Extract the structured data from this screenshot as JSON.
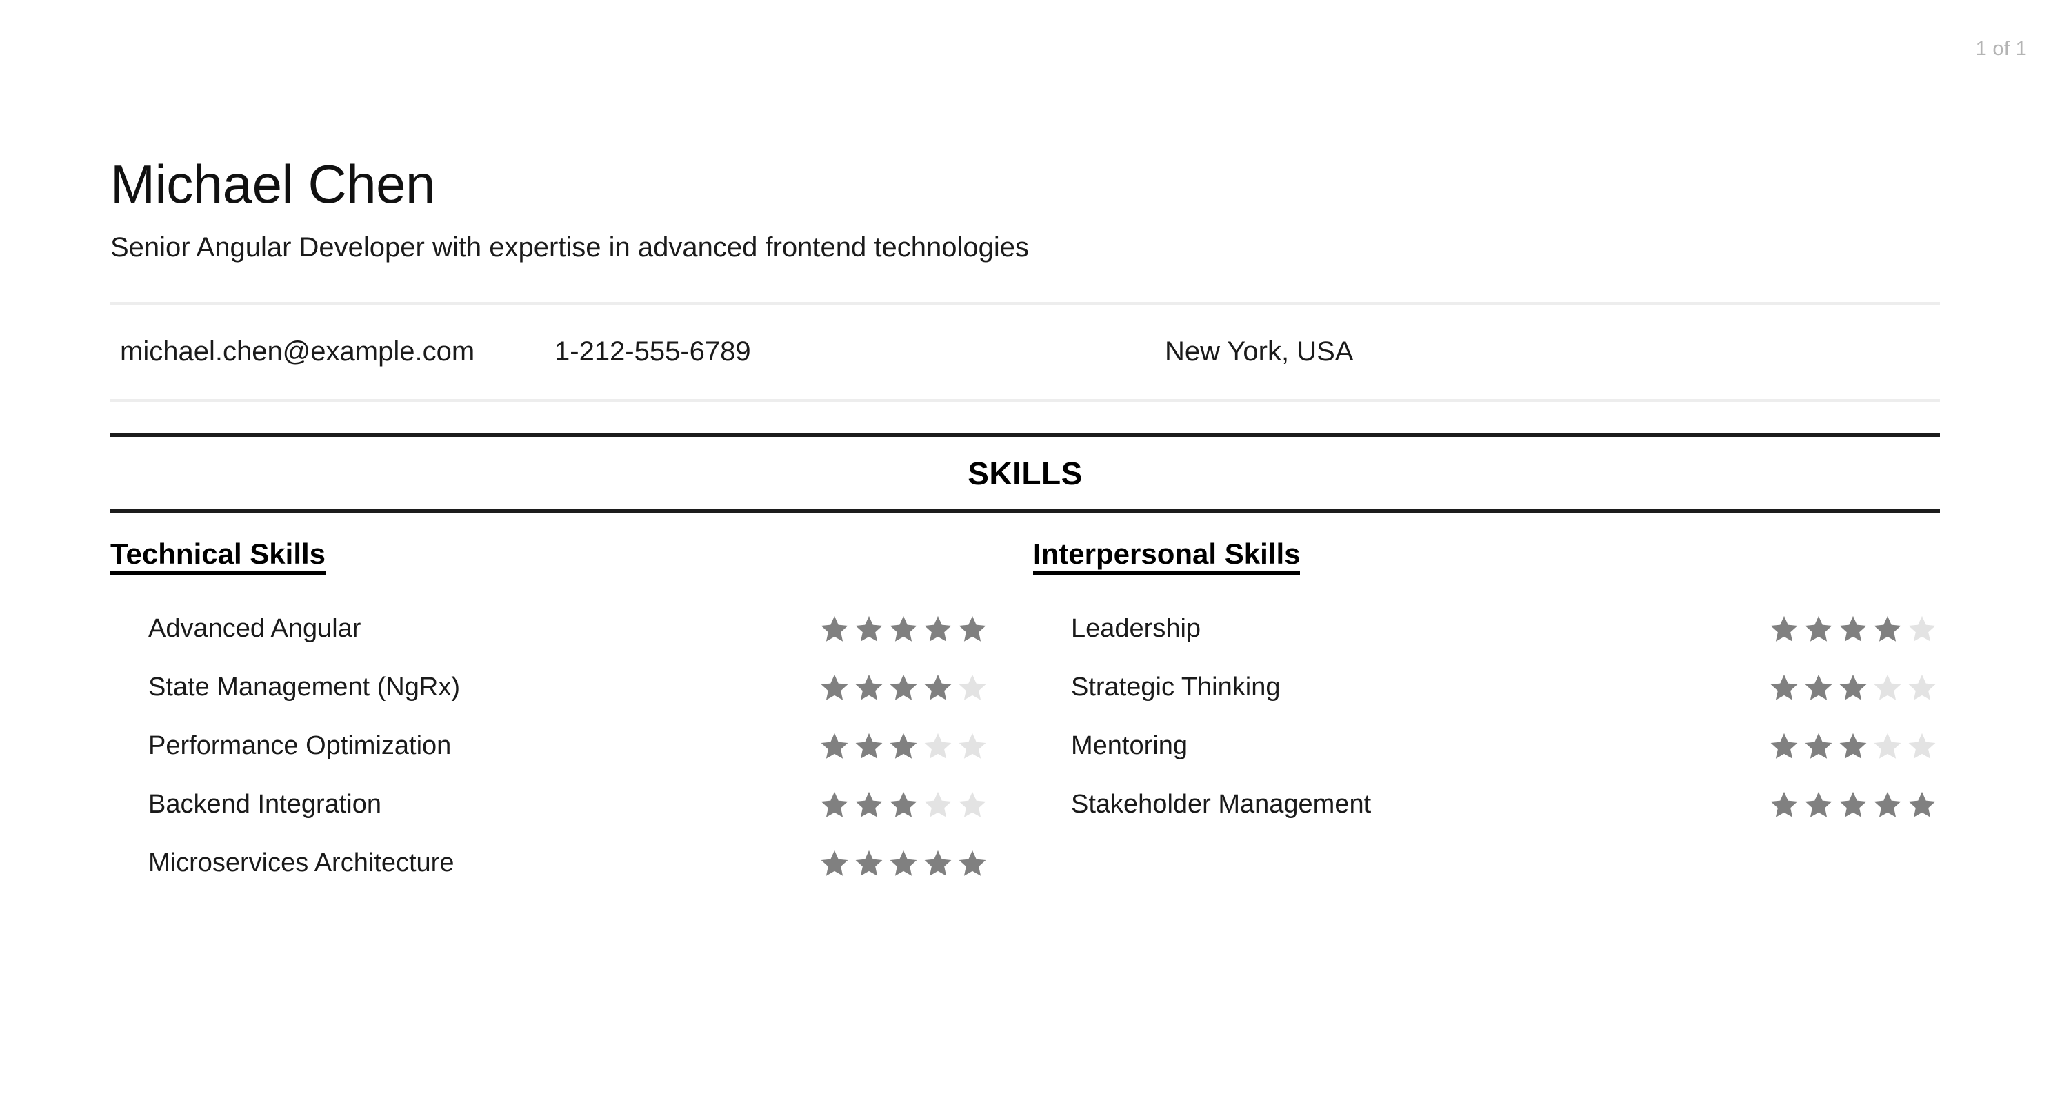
{
  "page_indicator": "1 of 1",
  "header": {
    "name": "Michael Chen",
    "tagline": "Senior Angular Developer with expertise in advanced frontend technologies"
  },
  "contact": {
    "email": "michael.chen@example.com",
    "phone": "1-212-555-6789",
    "location": "New York, USA"
  },
  "skills_section": {
    "title": "SKILLS",
    "columns": [
      {
        "heading": "Technical Skills",
        "items": [
          {
            "name": "Advanced Angular",
            "rating": 5
          },
          {
            "name": "State Management (NgRx)",
            "rating": 4
          },
          {
            "name": "Performance Optimization",
            "rating": 3
          },
          {
            "name": "Backend Integration",
            "rating": 3
          },
          {
            "name": "Microservices Architecture",
            "rating": 5
          }
        ]
      },
      {
        "heading": "Interpersonal Skills",
        "items": [
          {
            "name": "Leadership",
            "rating": 4
          },
          {
            "name": "Strategic Thinking",
            "rating": 3
          },
          {
            "name": "Mentoring",
            "rating": 3
          },
          {
            "name": "Stakeholder Management",
            "rating": 5
          }
        ]
      }
    ],
    "max_rating": 5
  },
  "colors": {
    "text": "#1a1a1a",
    "star_filled": "#808080",
    "star_empty": "#e3e3e3",
    "rule_dark": "#1c1c1c",
    "rule_light": "#ededed",
    "page_indicator": "#b4b4b4"
  }
}
